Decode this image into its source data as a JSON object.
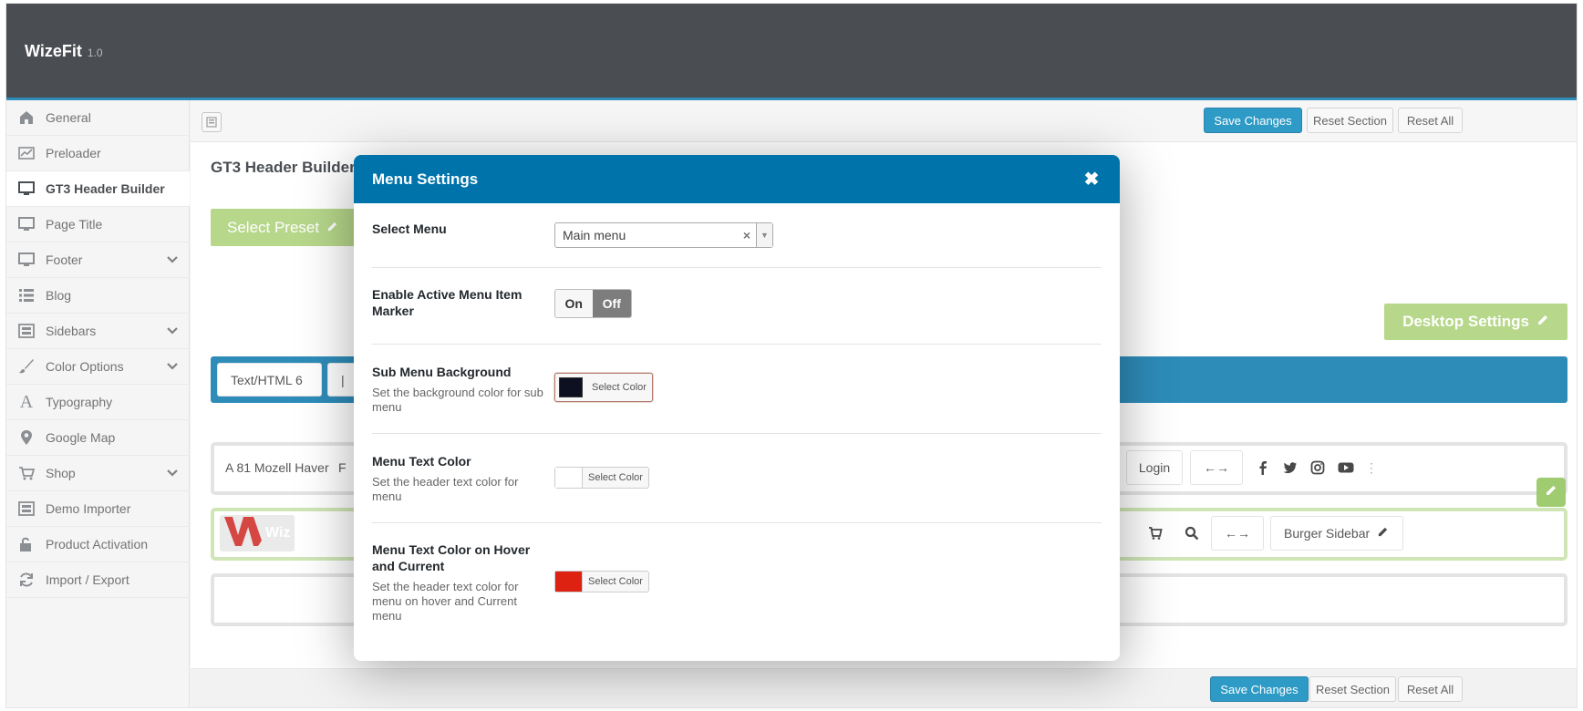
{
  "app": {
    "name": "WizeFit",
    "version": "1.0"
  },
  "sidebar": {
    "items": [
      {
        "label": "General",
        "icon": "home-icon"
      },
      {
        "label": "Preloader",
        "icon": "chart-icon"
      },
      {
        "label": "GT3 Header Builder",
        "icon": "monitor-icon",
        "active": true
      },
      {
        "label": "Page Title",
        "icon": "monitor-icon"
      },
      {
        "label": "Footer",
        "icon": "monitor-icon",
        "has_children": true
      },
      {
        "label": "Blog",
        "icon": "list-icon"
      },
      {
        "label": "Sidebars",
        "icon": "layout-icon",
        "has_children": true
      },
      {
        "label": "Color Options",
        "icon": "brush-icon",
        "has_children": true
      },
      {
        "label": "Typography",
        "icon": "typography-icon"
      },
      {
        "label": "Google Map",
        "icon": "map-pin-icon"
      },
      {
        "label": "Shop",
        "icon": "cart-icon",
        "has_children": true
      },
      {
        "label": "Demo Importer",
        "icon": "layout-icon"
      },
      {
        "label": "Product Activation",
        "icon": "unlock-icon"
      },
      {
        "label": "Import / Export",
        "icon": "refresh-icon"
      }
    ]
  },
  "toolbar": {
    "save_label": "Save Changes",
    "reset_section_label": "Reset Section",
    "reset_all_label": "Reset All"
  },
  "page": {
    "title": "GT3 Header Builder",
    "select_preset_label": "Select Preset",
    "desktop_settings_label": "Desktop Settings"
  },
  "builder": {
    "blue_row_chips": [
      "Text/HTML 6",
      "|"
    ],
    "top_row_left": "A  81 Mozell Haver",
    "top_row_partial": "F",
    "login_label": "Login",
    "spacer_label": "←→",
    "burger_label": "Burger Sidebar",
    "logo_text": "Wiz"
  },
  "modal": {
    "title": "Menu Settings",
    "fields": {
      "select_menu": {
        "title": "Select Menu",
        "value": "Main menu"
      },
      "active_marker": {
        "title": "Enable Active Menu Item Marker",
        "on": "On",
        "off": "Off"
      },
      "sub_bg": {
        "title": "Sub Menu Background",
        "desc": "Set the background color for sub menu",
        "button": "Select Color",
        "color": "#0c1020"
      },
      "text_color": {
        "title": "Menu Text Color",
        "desc": "Set the header text color for menu",
        "button": "Select Color",
        "color": "#ffffff"
      },
      "hover_color": {
        "title": "Menu Text Color on Hover and Current",
        "desc": "Set the header text color for menu on hover and Current menu",
        "button": "Select Color",
        "color": "#dd2211"
      }
    }
  },
  "colors": {
    "topbar": "#23282d",
    "accent": "#0073aa",
    "green": "#a8cf72",
    "primary_button": "#0085ba"
  }
}
